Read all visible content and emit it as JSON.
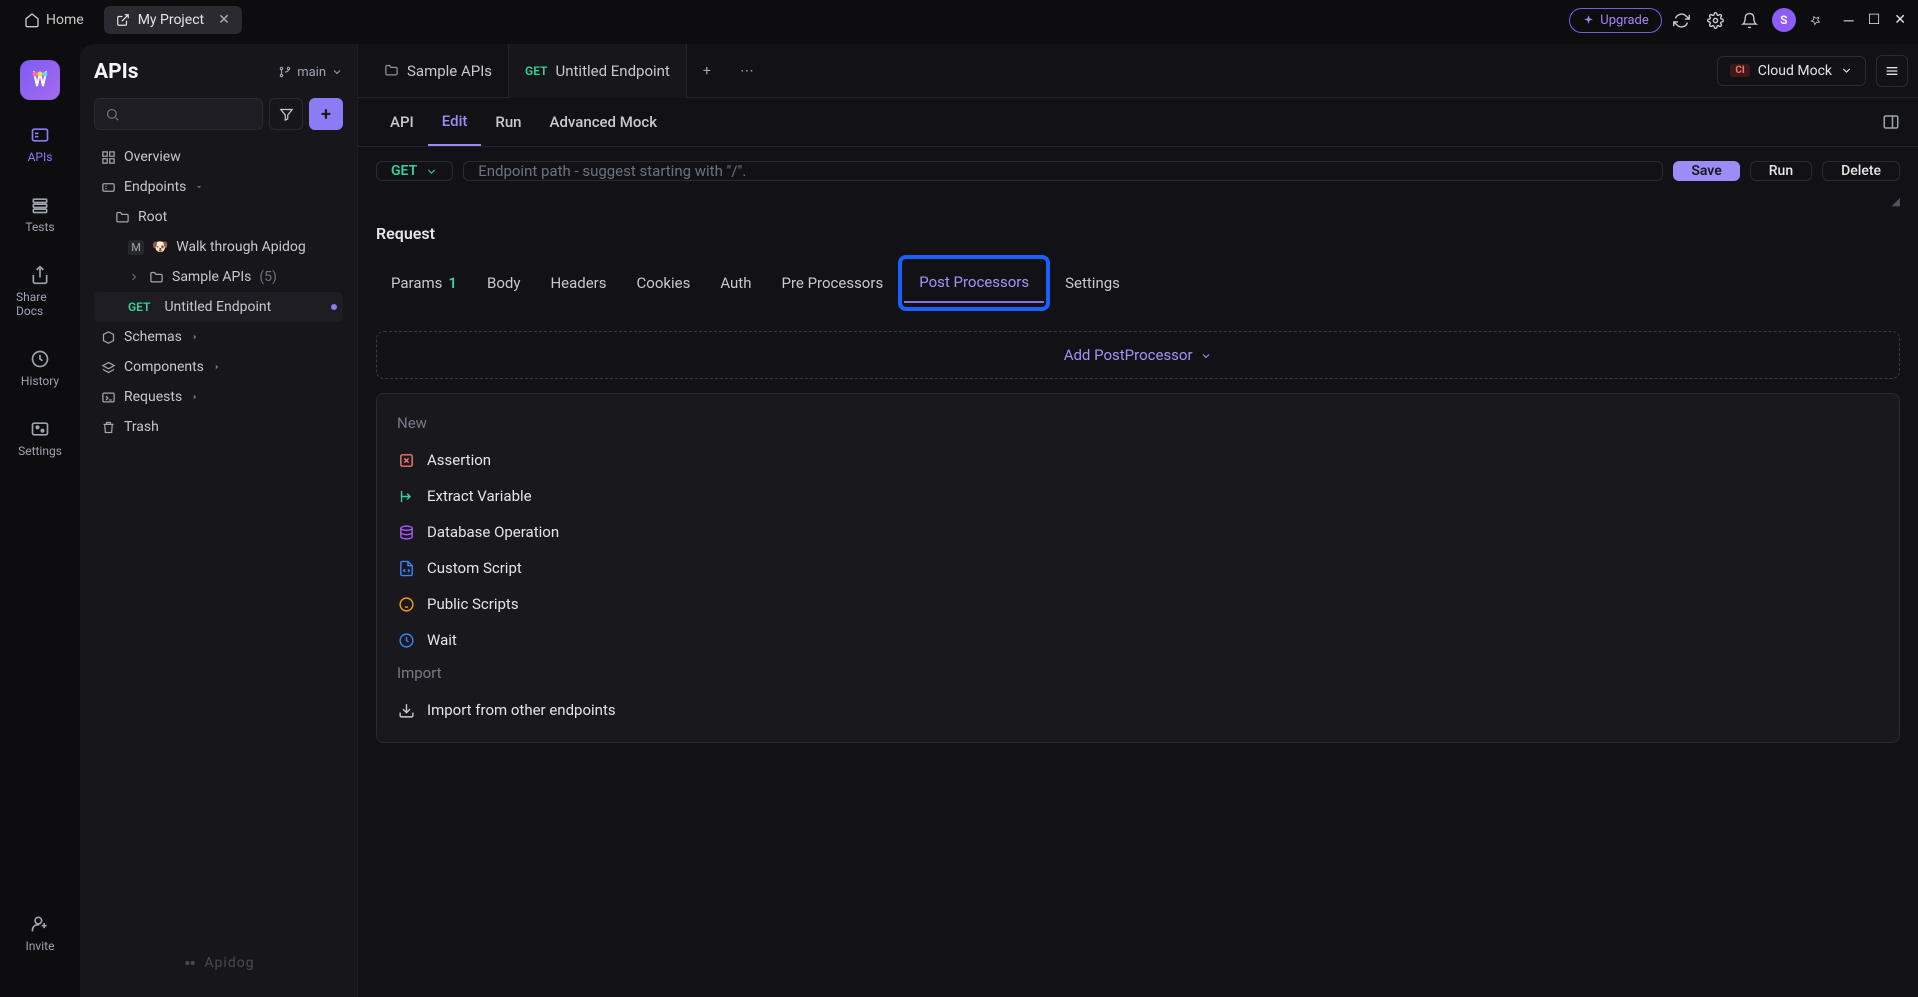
{
  "titlebar": {
    "home": "Home",
    "project": "My Project",
    "upgrade": "Upgrade",
    "avatar_initial": "S"
  },
  "leftrail": {
    "apis": "APIs",
    "tests": "Tests",
    "share": "Share Docs",
    "history": "History",
    "settings": "Settings",
    "invite": "Invite"
  },
  "sidebar": {
    "title": "APIs",
    "branch": "main",
    "overview": "Overview",
    "endpoints": "Endpoints",
    "root": "Root",
    "walkthrough": "Walk through Apidog",
    "sample_apis": "Sample APIs",
    "sample_count": "(5)",
    "untitled_method": "GET",
    "untitled": "Untitled Endpoint",
    "schemas": "Schemas",
    "components": "Components",
    "requests": "Requests",
    "trash": "Trash",
    "footer": "Apidog"
  },
  "tabs": {
    "sample": "Sample APIs",
    "active_method": "GET",
    "active_name": "Untitled Endpoint",
    "env": "Cloud Mock",
    "env_badge": "CI"
  },
  "subnav": {
    "api": "API",
    "edit": "Edit",
    "run": "Run",
    "advanced": "Advanced Mock"
  },
  "endpoint": {
    "method": "GET",
    "path_placeholder": "Endpoint path - suggest starting with \"/\".",
    "save": "Save",
    "run": "Run",
    "delete": "Delete"
  },
  "request": {
    "title": "Request",
    "tabs": {
      "params": "Params",
      "params_badge": "1",
      "body": "Body",
      "headers": "Headers",
      "cookies": "Cookies",
      "auth": "Auth",
      "pre": "Pre Processors",
      "post": "Post Processors",
      "settings": "Settings"
    },
    "add_post": "Add PostProcessor"
  },
  "proc_menu": {
    "new_label": "New",
    "assertion": "Assertion",
    "extract": "Extract Variable",
    "database": "Database Operation",
    "custom": "Custom Script",
    "public": "Public Scripts",
    "wait": "Wait",
    "import_label": "Import",
    "import_other": "Import from other endpoints"
  }
}
